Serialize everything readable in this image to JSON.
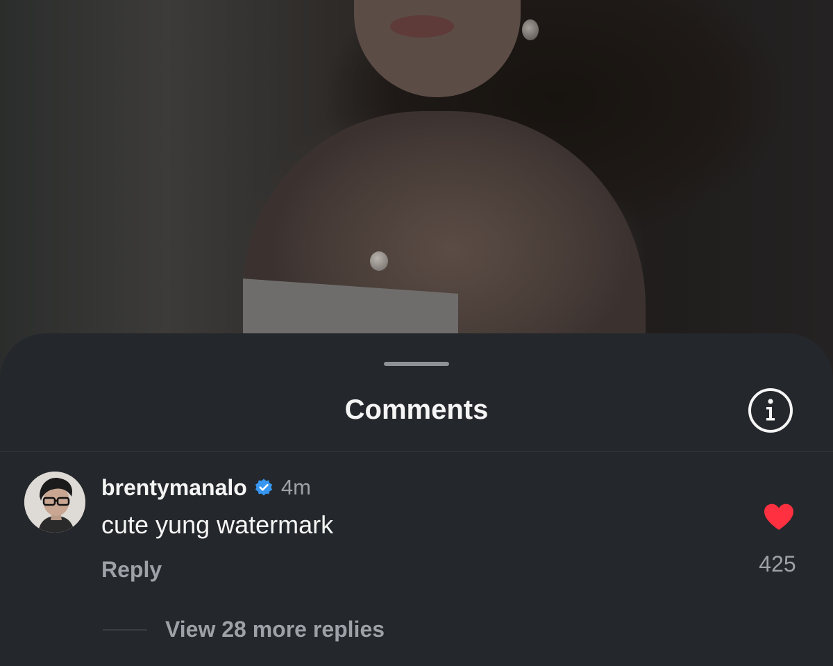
{
  "sheet": {
    "title": "Comments"
  },
  "comment": {
    "username": "brentymanalo",
    "verified": true,
    "timestamp": "4m",
    "text": "cute yung watermark",
    "reply_label": "Reply",
    "liked": true,
    "like_count": "425",
    "view_replies_label": "View 28 more replies"
  },
  "icons": {
    "info": "info-circle-icon",
    "verified": "verified-badge-icon",
    "like": "heart-icon"
  },
  "colors": {
    "sheet_background": "#24272b",
    "verified_blue": "#3797f0",
    "like_red": "#ff3040",
    "secondary_text": "#9ea1a7"
  }
}
